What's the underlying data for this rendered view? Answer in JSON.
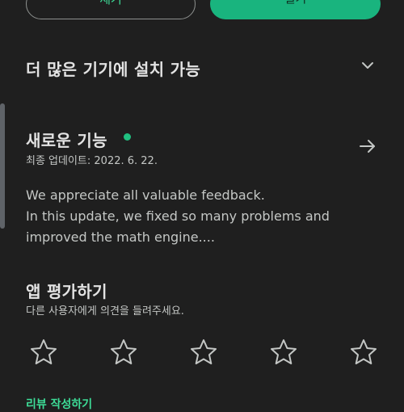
{
  "buttons": {
    "remove_label": "제거",
    "open_label": "열기"
  },
  "devices_section": {
    "title": "더 많은 기기에 설치 가능",
    "icon": "chevron-down-icon"
  },
  "whats_new": {
    "title": "새로운 기능",
    "updated": "최종 업데이트: 2022. 6. 22.",
    "notes": [
      "We appreciate all valuable feedback.",
      "In this update, we fixed so many problems and",
      "improved the math engine...."
    ],
    "icon": "arrow-right-icon"
  },
  "rate_app": {
    "title": "앱 평가하기",
    "subtitle": "다른 사용자에게 의견을 들려주세요.",
    "star_count": 5
  },
  "bottom_link": "리뷰 작성하기",
  "colors": {
    "accent": "#19b47e",
    "background": "#1f1f1f",
    "dot": "#20c080"
  }
}
